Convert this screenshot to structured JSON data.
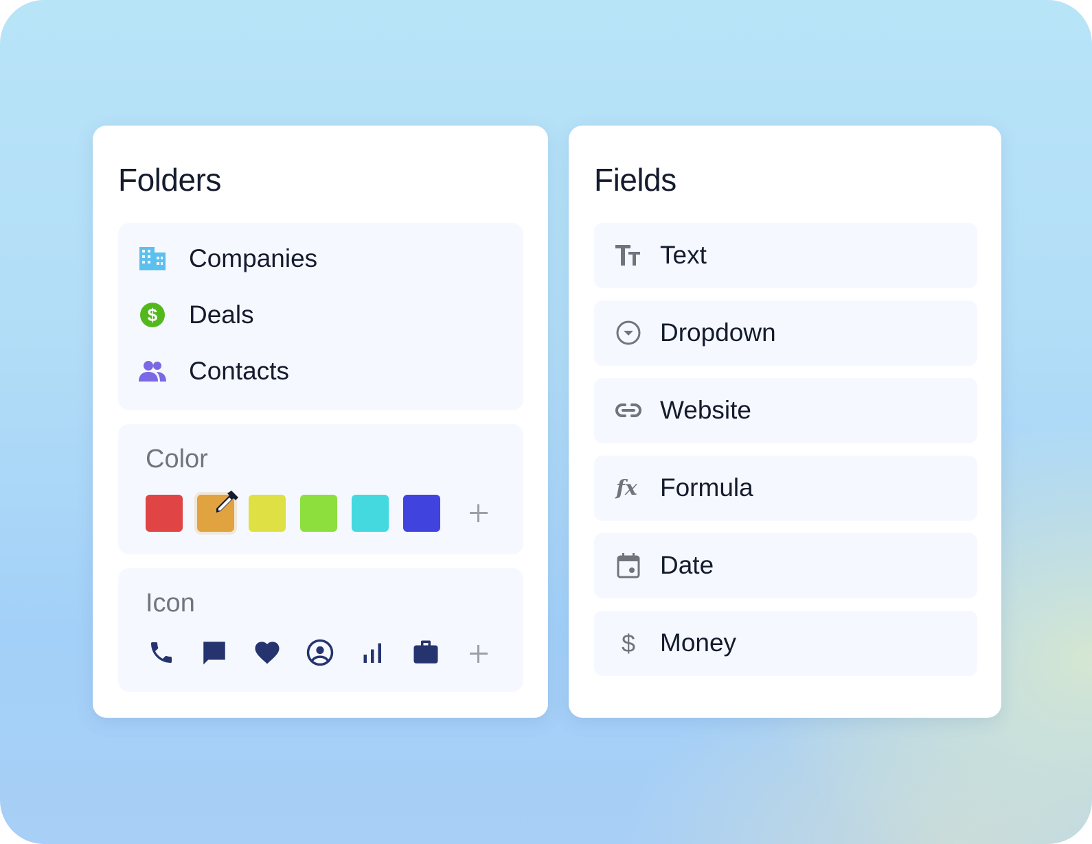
{
  "folders_card": {
    "title": "Folders",
    "items": [
      {
        "label": "Companies",
        "icon": "building-icon",
        "icon_color": "#5cc0ef"
      },
      {
        "label": "Deals",
        "icon": "dollar-circle-icon",
        "icon_color": "#52b81c"
      },
      {
        "label": "Contacts",
        "icon": "users-icon",
        "icon_color": "#7b68e4"
      }
    ],
    "color_section": {
      "label": "Color",
      "swatches": [
        {
          "name": "red",
          "hex": "#e04444"
        },
        {
          "name": "orange",
          "hex": "#e0a340",
          "selected": true
        },
        {
          "name": "yellow",
          "hex": "#dfe043"
        },
        {
          "name": "green",
          "hex": "#8ddf3e"
        },
        {
          "name": "cyan",
          "hex": "#43d9de"
        },
        {
          "name": "blue",
          "hex": "#4043de"
        }
      ],
      "add_label": "+"
    },
    "icon_section": {
      "label": "Icon",
      "icons": [
        "phone-icon",
        "chat-bubble-icon",
        "heart-icon",
        "user-circle-icon",
        "bar-chart-icon",
        "briefcase-icon"
      ],
      "icon_color": "#25336e",
      "add_label": "+"
    }
  },
  "fields_card": {
    "title": "Fields",
    "items": [
      {
        "label": "Text",
        "icon": "text-type-icon"
      },
      {
        "label": "Dropdown",
        "icon": "dropdown-circle-icon"
      },
      {
        "label": "Website",
        "icon": "link-icon"
      },
      {
        "label": "Formula",
        "icon": "function-icon"
      },
      {
        "label": "Date",
        "icon": "calendar-icon"
      },
      {
        "label": "Money",
        "icon": "dollar-icon"
      }
    ],
    "icon_color": "#71747d"
  }
}
